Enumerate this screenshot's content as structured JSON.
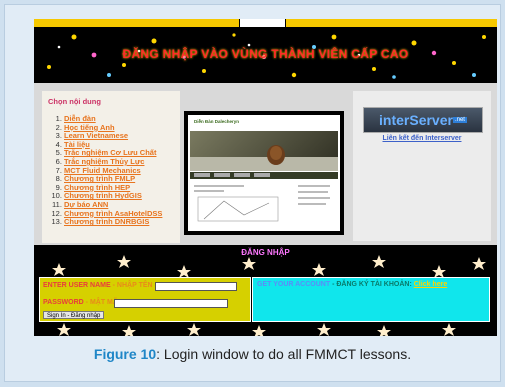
{
  "banner": {
    "title": "ĐĂNG NHẬP VÀO VÙNG THÀNH VIÊN CẤP CAO"
  },
  "menu": {
    "title": "Chọn nội dung",
    "items": [
      "Diễn đàn",
      "Học tiếng Anh",
      "Learn Vietnamese",
      "Tài liệu",
      "Trắc nghiệm Cơ Lưu Chất",
      "Trắc nghiệm Thủy Lực",
      "MCT Fluid Mechanics",
      "Chương trình FMLP",
      "Chương trình HEP",
      "Chương trình HydGIS",
      "Dự báo ANN",
      "Chương trình AsaHotelDSS",
      "Chương trình DNRBGIS"
    ]
  },
  "preview": {
    "heading": "Diễn Đàn Dalecheryn",
    "subheading": ""
  },
  "partner": {
    "logo_text": "interServer",
    "logo_suffix": ".net",
    "link": "Liên kết đến Interserver"
  },
  "login": {
    "title": "ĐĂNG NHẬP",
    "username_label": "ENTER USER NAME",
    "username_label_vi": "- NHẬP TÊN",
    "password_label": "PASSWORD",
    "password_label_vi": "- MẬT MÃ",
    "submit": "Sign In - Đăng nhập"
  },
  "account": {
    "text": "GET YOUR ACCOUNT",
    "text_vi": "- ĐĂNG KÝ TÀI KHOẢN:",
    "link": "Click here"
  },
  "caption": {
    "label": "Figure 10",
    "text": ": Login window to do all FMMCT lessons."
  },
  "colors": {
    "accent": "#1f86c7",
    "banner_title": "#ff2a2a",
    "menu_link": "#e8741e",
    "form_bg": "#d6d000",
    "account_bg": "#10e6ec"
  }
}
